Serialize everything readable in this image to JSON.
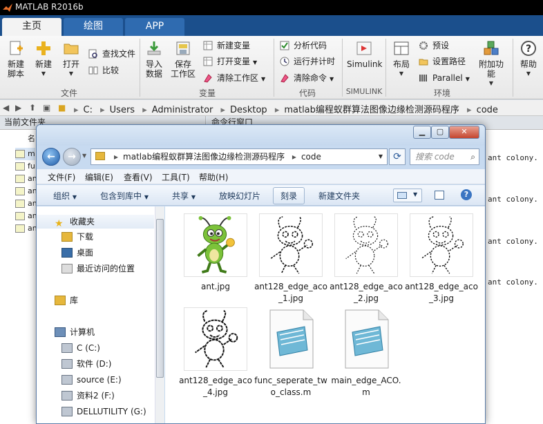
{
  "matlab": {
    "title": "MATLAB R2016b",
    "tabs": [
      {
        "label": "主页"
      },
      {
        "label": "绘图"
      },
      {
        "label": "APP"
      }
    ],
    "ribbon": {
      "new_script": "新建\n脚本",
      "new": "新建",
      "open": "打开",
      "find_files": "查找文件",
      "compare": "比较",
      "import_data": "导入\n数据",
      "save_workspace": "保存\n工作区",
      "new_variable": "新建变量",
      "open_variable": "打开变量",
      "clear_workspace": "清除工作区",
      "analyze_code": "分析代码",
      "run_and_time": "运行并计时",
      "clear_commands": "清除命令",
      "simulink": "Simulink",
      "layout": "布局",
      "preferences": "预设",
      "set_path": "设置路径",
      "parallel": "Parallel",
      "addons": "附加功能",
      "help": "帮助",
      "groups": {
        "file": "文件",
        "variable": "变量",
        "code": "代码",
        "simulink": "SIMULINK",
        "environment": "环境"
      }
    },
    "path": [
      "C:",
      "Users",
      "Administrator",
      "Desktop",
      "matlab编程蚁群算法图像边缘检测源码程序",
      "code"
    ],
    "current_folder_header": "当前文件夹",
    "name_col": "名",
    "files": [
      "m",
      "fu",
      "an",
      "an",
      "an",
      "an",
      "an"
    ],
    "command_window_header": "命令行窗口",
    "command_lines": [
      "ant colony.",
      "ant colony.",
      "ant colony.",
      "ant colony."
    ]
  },
  "explorer": {
    "path": [
      "matlab编程蚁群算法图像边缘检测源码程序",
      "code"
    ],
    "search_placeholder": "搜索 code",
    "menu": [
      "文件(F)",
      "编辑(E)",
      "查看(V)",
      "工具(T)",
      "帮助(H)"
    ],
    "toolbar": {
      "organize": "组织",
      "include_library": "包含到库中",
      "share": "共享",
      "slideshow": "放映幻灯片",
      "burn": "刻录",
      "new_folder": "新建文件夹"
    },
    "nav": {
      "favorites": "收藏夹",
      "downloads": "下载",
      "desktop": "桌面",
      "recent": "最近访问的位置",
      "libraries": "库",
      "computer": "计算机",
      "drive_c": "C (C:)",
      "drive_d": "软件 (D:)",
      "drive_e": "source (E:)",
      "drive_f": "资料2 (F:)",
      "drive_g": "DELLUTILITY (G:)"
    },
    "files": [
      {
        "name": "ant.jpg",
        "icon": "ant-cartoon-thumbnail"
      },
      {
        "name": "ant128_edge_aco_1.jpg",
        "icon": "edge-image-thumbnail"
      },
      {
        "name": "ant128_edge_aco_2.jpg",
        "icon": "edge-image-thumbnail"
      },
      {
        "name": "ant128_edge_aco_3.jpg",
        "icon": "edge-image-thumbnail"
      },
      {
        "name": "ant128_edge_aco_4.jpg",
        "icon": "edge-image-thumbnail"
      },
      {
        "name": "func_seperate_two_class.m",
        "icon": "m-file-icon"
      },
      {
        "name": "main_edge_ACO.m",
        "icon": "m-file-icon"
      }
    ]
  }
}
